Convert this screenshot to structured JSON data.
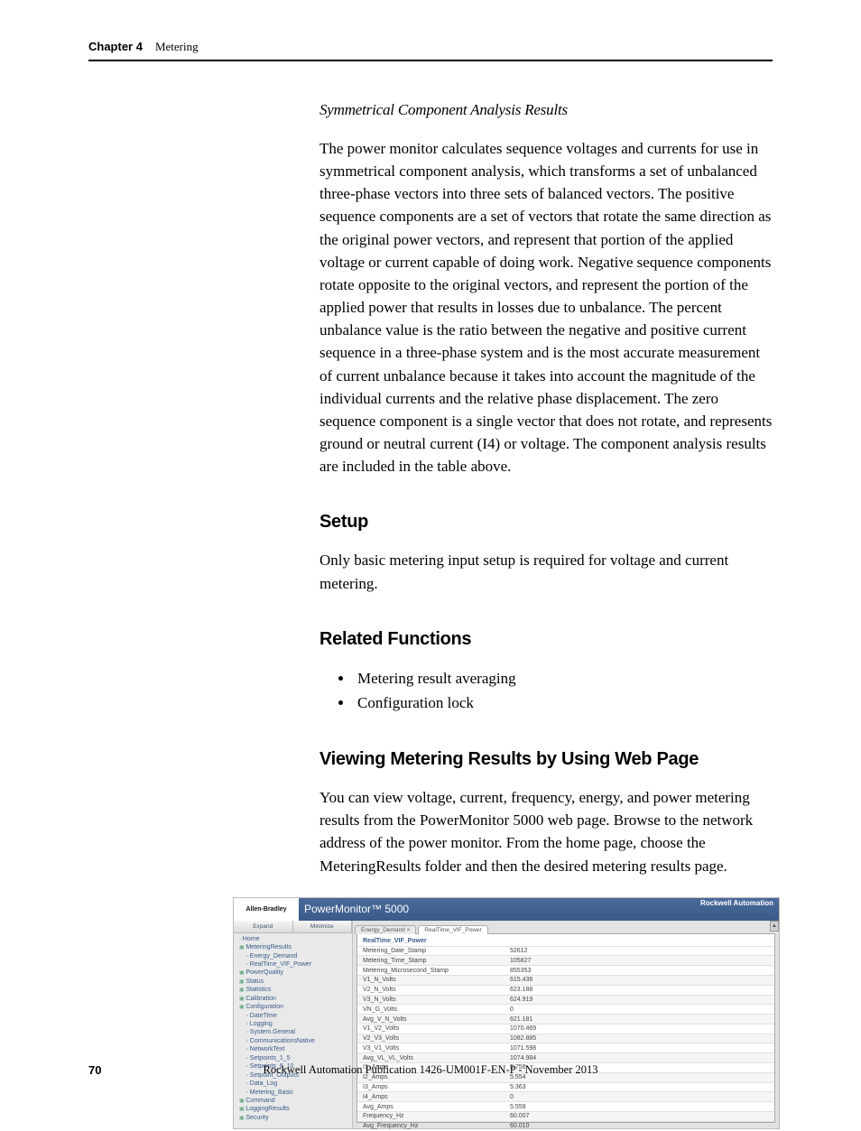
{
  "header": {
    "chapter": "Chapter 4",
    "section": "Metering"
  },
  "subsection_title": "Symmetrical Component Analysis Results",
  "para1": "The power monitor calculates sequence voltages and currents for use in symmetrical component analysis, which transforms a set of unbalanced three-phase vectors into three sets of balanced vectors. The positive sequence components are a set of vectors that rotate the same direction as the original power vectors, and represent that portion of the applied voltage or current capable of doing work. Negative sequence components rotate opposite to the original vectors, and represent the portion of the applied power that results in losses due to unbalance. The percent unbalance value is the ratio between the negative and positive current sequence in a three-phase system and is the most accurate measurement of current unbalance because it takes into account the magnitude of the individual currents and the relative phase displacement. The zero sequence component is a single vector that does not rotate, and represents ground or neutral current (I4) or voltage. The component analysis results are included in the table above.",
  "setup_heading": "Setup",
  "setup_para": "Only basic metering input setup is required for voltage and current metering.",
  "related_heading": "Related Functions",
  "related_bullets": [
    "Metering result averaging",
    "Configuration lock"
  ],
  "viewing_heading": "Viewing Metering Results by Using Web Page",
  "viewing_para": "You can view voltage, current, frequency, energy, and power metering results from the PowerMonitor 5000 web page. Browse to the network address of the power monitor. From the home page, choose the MeteringResults folder and then the desired metering results page.",
  "screenshot": {
    "logo_text": "Allen-Bradley",
    "app_title": "PowerMonitor™ 5000",
    "brand_right": "Rockwell Automation",
    "sidebar_buttons": [
      "Expand",
      "Minimize"
    ],
    "tree": [
      {
        "lv": 0,
        "cls": "page-icon",
        "t": "Home"
      },
      {
        "lv": 0,
        "cls": "folder",
        "t": "MeteringResults"
      },
      {
        "lv": 1,
        "cls": "page-icon",
        "t": "Energy_Demand"
      },
      {
        "lv": 1,
        "cls": "page-icon",
        "t": "RealTime_VIF_Power"
      },
      {
        "lv": 0,
        "cls": "folder",
        "t": "PowerQuality"
      },
      {
        "lv": 0,
        "cls": "folder",
        "t": "Status"
      },
      {
        "lv": 0,
        "cls": "folder",
        "t": "Statistics"
      },
      {
        "lv": 0,
        "cls": "folder",
        "t": "Calibration"
      },
      {
        "lv": 0,
        "cls": "folder",
        "t": "Configuration"
      },
      {
        "lv": 1,
        "cls": "page-icon",
        "t": "DateTime"
      },
      {
        "lv": 1,
        "cls": "page-icon",
        "t": "Logging"
      },
      {
        "lv": 1,
        "cls": "page-icon",
        "t": "System.General"
      },
      {
        "lv": 1,
        "cls": "page-icon",
        "t": "CommunicationsNative"
      },
      {
        "lv": 1,
        "cls": "page-icon",
        "t": "NetworkText"
      },
      {
        "lv": 1,
        "cls": "page-icon",
        "t": "Setpoints_1_5"
      },
      {
        "lv": 1,
        "cls": "page-icon",
        "t": "Setpoints_6_10"
      },
      {
        "lv": 1,
        "cls": "page-icon",
        "t": "Setpoint_Outputs"
      },
      {
        "lv": 1,
        "cls": "page-icon",
        "t": "Data_Log"
      },
      {
        "lv": 1,
        "cls": "page-icon",
        "t": "Metering_Basic"
      },
      {
        "lv": 0,
        "cls": "folder",
        "t": "Command"
      },
      {
        "lv": 0,
        "cls": "folder",
        "t": "LoggingResults"
      },
      {
        "lv": 0,
        "cls": "folder",
        "t": "Security"
      }
    ],
    "tabs": [
      "Energy_Demand ×",
      "RealTime_VIF_Power"
    ],
    "active_tab_index": 1,
    "panel_title": "RealTime_VIF_Power",
    "rows": [
      {
        "l": "Metering_Date_Stamp",
        "r": "52612"
      },
      {
        "l": "Metering_Time_Stamp",
        "r": "105827"
      },
      {
        "l": "Metering_Microsecond_Stamp",
        "r": "855353"
      },
      {
        "l": "V1_N_Volts",
        "r": "615.436"
      },
      {
        "l": "V2_N_Volts",
        "r": "623.188"
      },
      {
        "l": "V3_N_Volts",
        "r": "624.919"
      },
      {
        "l": "VN_G_Volts",
        "r": "0"
      },
      {
        "l": "Avg_V_N_Volts",
        "r": "621.181"
      },
      {
        "l": "V1_V2_Volts",
        "r": "1070.469"
      },
      {
        "l": "V2_V3_Volts",
        "r": "1082.885"
      },
      {
        "l": "V3_V1_Volts",
        "r": "1071.598"
      },
      {
        "l": "Avg_VL_VL_Volts",
        "r": "1074.984"
      },
      {
        "l": "I1_Amps",
        "r": "5.756"
      },
      {
        "l": "I2_Amps",
        "r": "5.554"
      },
      {
        "l": "I3_Amps",
        "r": "5.363"
      },
      {
        "l": "I4_Amps",
        "r": "0"
      },
      {
        "l": "Avg_Amps",
        "r": "5.559"
      },
      {
        "l": "Frequency_Hz",
        "r": "60.007"
      },
      {
        "l": "Avg_Frequency_Hz",
        "r": "60.010"
      }
    ]
  },
  "footer": {
    "page_number": "70",
    "publication": "Rockwell Automation Publication 1426-UM001F-EN-P - November 2013"
  }
}
